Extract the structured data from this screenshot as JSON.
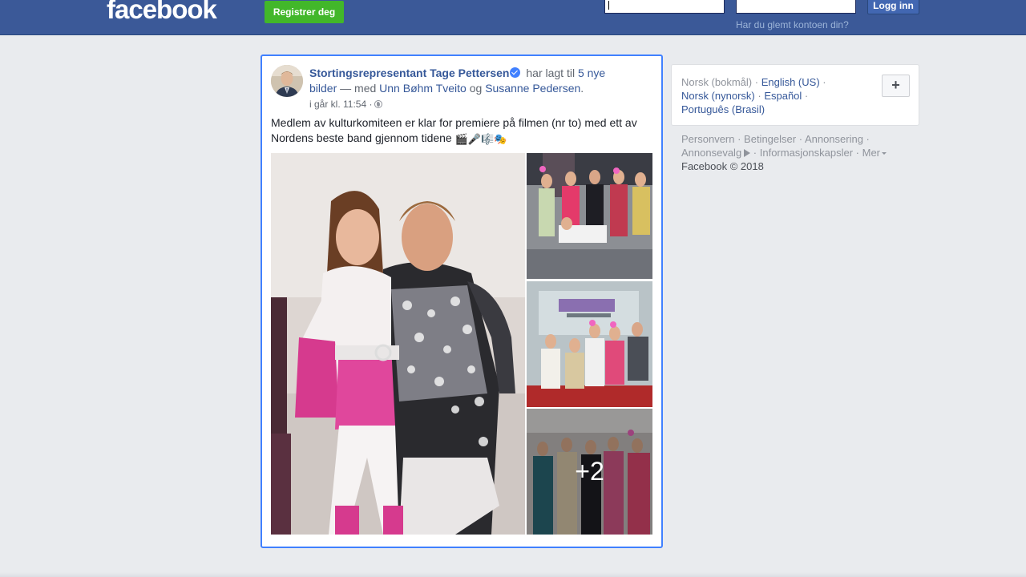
{
  "header": {
    "logo": "facebook",
    "register_label": "Registrer deg",
    "login_label": "Logg inn",
    "forgot_label": "Har du glemt kontoen din?",
    "brand_color": "#3b5998"
  },
  "post": {
    "author": "Stortingsrepresentant Tage Pettersen",
    "verified": true,
    "action_text": " har lagt til ",
    "photos_link": "5 nye bilder",
    "with_text": " — med ",
    "tagged_1": "Unn Bøhm Tveito",
    "and_text": " og ",
    "tagged_2": "Susanne Pedersen",
    "end_text": ".",
    "timestamp": "i går kl. 11:54 ·",
    "text": "Medlem av kulturkomiteen er klar for premiere på filmen (nr to) med ett av Nordens beste band gjennom tidene ",
    "emojis": "🎬🎤🎼🎭",
    "photos": {
      "more_count": "+2"
    }
  },
  "languages": {
    "current": "Norsk (bokmål)",
    "items": [
      "English (US)",
      "Norsk (nynorsk)",
      "Español",
      "Português (Brasil)"
    ],
    "add_label": "+"
  },
  "footer": {
    "links": [
      "Personvern",
      "Betingelser",
      "Annonsering",
      "Annonsevalg",
      "Informasjonskapsler",
      "Mer"
    ],
    "copyright": "Facebook © 2018"
  }
}
